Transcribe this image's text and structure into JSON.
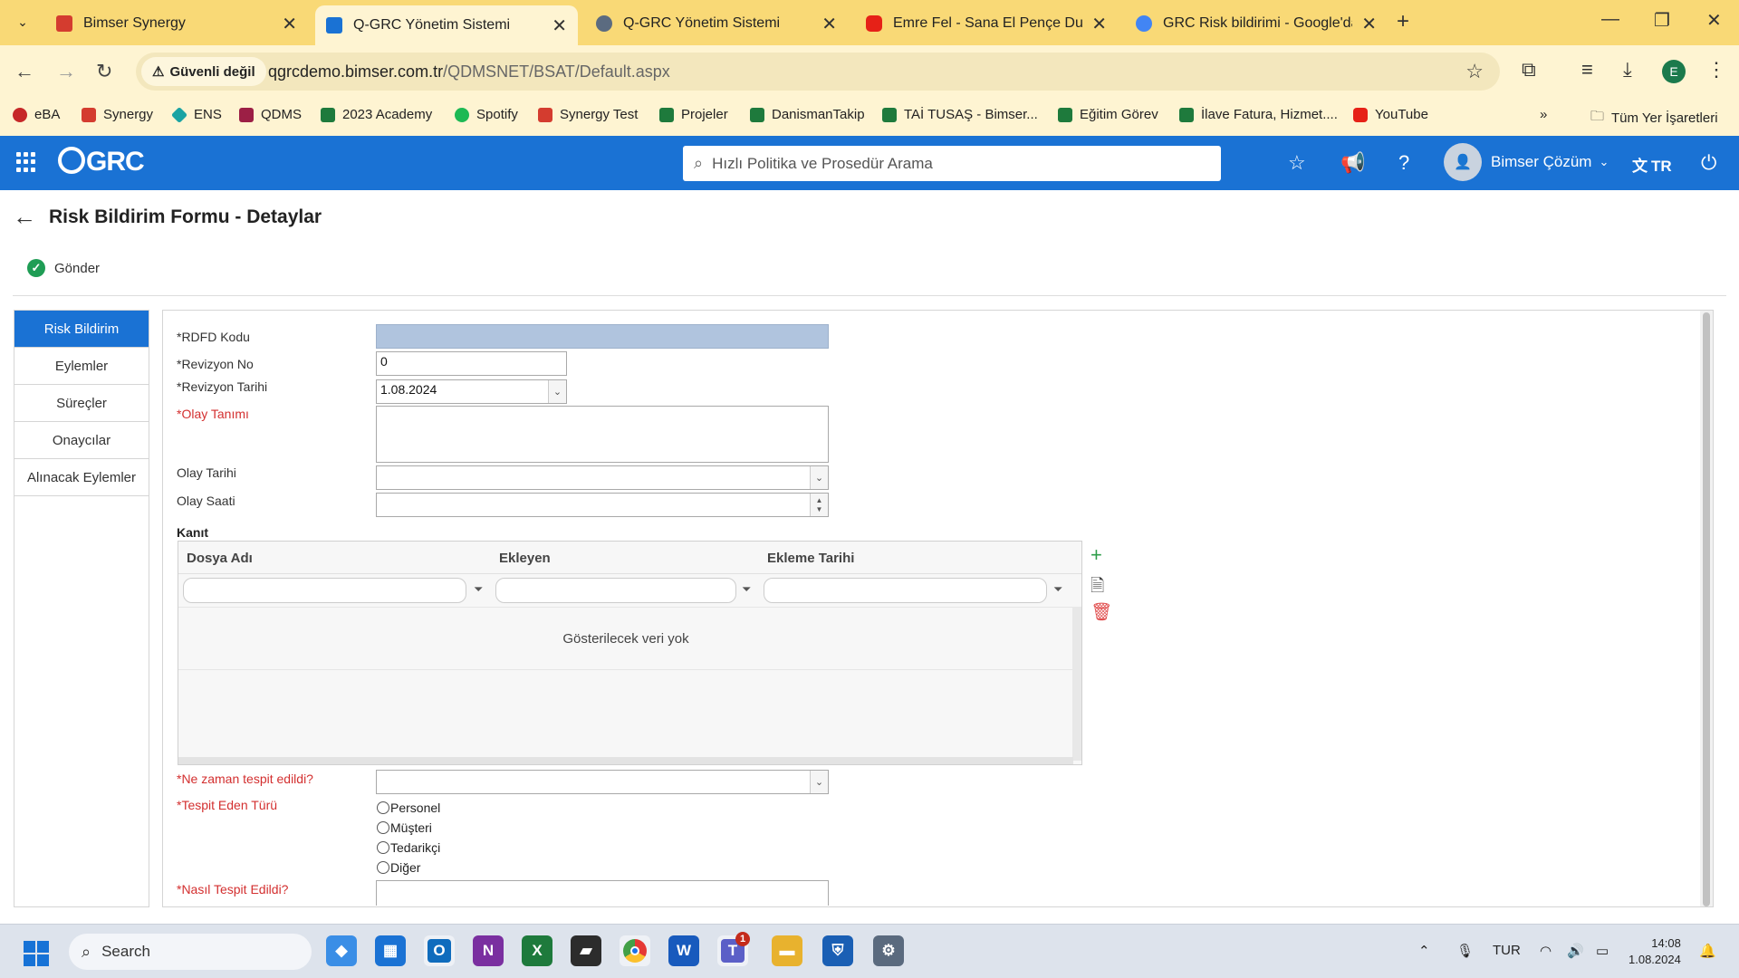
{
  "browser": {
    "tabs": [
      {
        "title": "Bimser Synergy",
        "favicon_color": "#d43c2f"
      },
      {
        "title": "Q-GRC Yönetim Sistemi",
        "favicon_color": "#1a72d4"
      },
      {
        "title": "Q-GRC Yönetim Sistemi",
        "favicon_color": "#5b6b80"
      },
      {
        "title": "Emre Fel - Sana El Pençe Durma",
        "favicon_color": "#e62117"
      },
      {
        "title": "GRC Risk bildirimi - Google'da /",
        "favicon_color": "#4285f4"
      }
    ],
    "security_label": "Güvenli değil",
    "url_host": "qgrcdemo.bimser.com.tr",
    "url_path": "/QDMSNET/BSAT/Default.aspx",
    "profile_initial": "E",
    "bookmarks": [
      {
        "label": "eBA",
        "color": "#c62828"
      },
      {
        "label": "Synergy",
        "color": "#d43c2f"
      },
      {
        "label": "ENS",
        "color": "#1aa3a3"
      },
      {
        "label": "QDMS",
        "color": "#9c1f45"
      },
      {
        "label": "2023 Academy",
        "color": "#1e7a3c"
      },
      {
        "label": "Spotify",
        "color": "#1db954"
      },
      {
        "label": "Synergy Test",
        "color": "#d43c2f"
      },
      {
        "label": "Projeler",
        "color": "#1e7a3c"
      },
      {
        "label": "DanismanTakip",
        "color": "#1e7a3c"
      },
      {
        "label": "TAİ TUSAŞ - Bimser...",
        "color": "#1e7a3c"
      },
      {
        "label": "Eğitim Görev",
        "color": "#1e7a3c"
      },
      {
        "label": "İlave Fatura, Hizmet....",
        "color": "#1e7a3c"
      },
      {
        "label": "YouTube",
        "color": "#e62117"
      }
    ],
    "all_bookmarks_label": "Tüm Yer İşaretleri"
  },
  "app": {
    "logo_text": "GRC",
    "search_placeholder": "Hızlı Politika ve Prosedür Arama",
    "user_name": "Bimser Çözüm",
    "language": "TR"
  },
  "page": {
    "title": "Risk Bildirim Formu - Detaylar",
    "send_label": "Gönder"
  },
  "sidenav": [
    {
      "label": "Risk Bildirim",
      "active": true
    },
    {
      "label": "Eylemler",
      "active": false
    },
    {
      "label": "Süreçler",
      "active": false
    },
    {
      "label": "Onaycılar",
      "active": false
    },
    {
      "label": "Alınacak Eylemler",
      "active": false
    }
  ],
  "form": {
    "rdfd_kodu_label": "*RDFD Kodu",
    "rdfd_kodu_value": "",
    "revizyon_no_label": "*Revizyon No",
    "revizyon_no_value": "0",
    "revizyon_tarihi_label": "*Revizyon Tarihi",
    "revizyon_tarihi_value": "1.08.2024",
    "olay_tanimi_label": "*Olay Tanımı",
    "olay_tanimi_value": "",
    "olay_tarihi_label": "Olay Tarihi",
    "olay_tarihi_value": "",
    "olay_saati_label": "Olay Saati",
    "olay_saati_value": "",
    "kanit_label": "Kanıt",
    "grid_columns": [
      "Dosya Adı",
      "Ekleyen",
      "Ekleme Tarihi"
    ],
    "grid_empty_text": "Gösterilecek veri yok",
    "ne_zaman_label": "*Ne zaman tespit edildi?",
    "ne_zaman_value": "",
    "tespit_eden_label": "*Tespit Eden Türü",
    "tespit_eden_options": [
      "Personel",
      "Müşteri",
      "Tedarikçi",
      "Diğer"
    ],
    "nasil_label": "*Nasıl Tespit Edildi?",
    "nasil_value": ""
  },
  "taskbar": {
    "search_label": "Search",
    "language_indicator": "TUR",
    "time": "14:08",
    "date": "1.08.2024",
    "teams_badge": "1"
  },
  "colors": {
    "brand_blue": "#1a72d4",
    "required_red": "#d32f2f",
    "chrome_tabstrip": "#f9d976",
    "send_green": "#1f9d55"
  }
}
